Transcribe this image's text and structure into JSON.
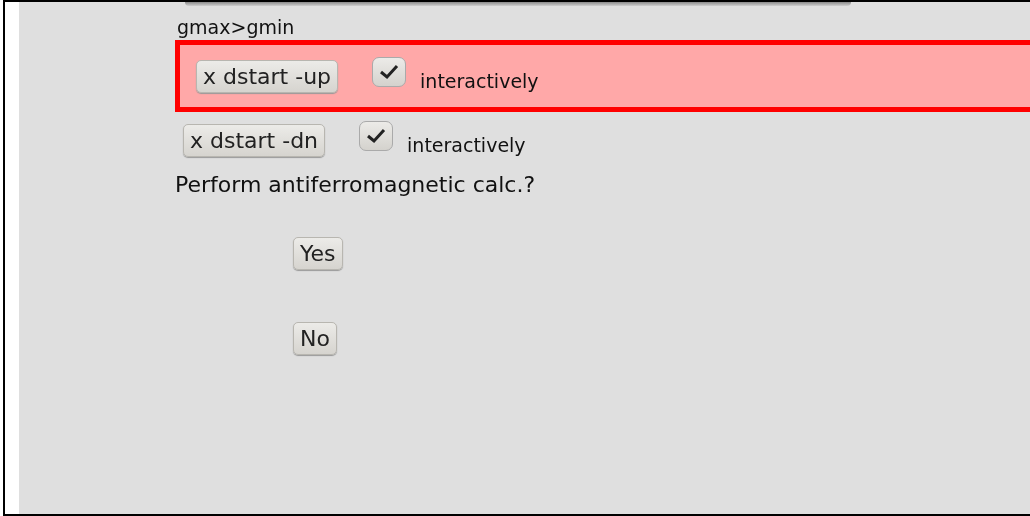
{
  "condition_label": "gmax>gmin",
  "rows": [
    {
      "button": "x dstart -up",
      "checked": true,
      "checkbox_label": "interactively",
      "highlighted": true
    },
    {
      "button": "x dstart -dn",
      "checked": true,
      "checkbox_label": "interactively",
      "highlighted": false
    }
  ],
  "question": "Perform antiferromagnetic calc.?",
  "answers": [
    "Yes",
    "No"
  ]
}
